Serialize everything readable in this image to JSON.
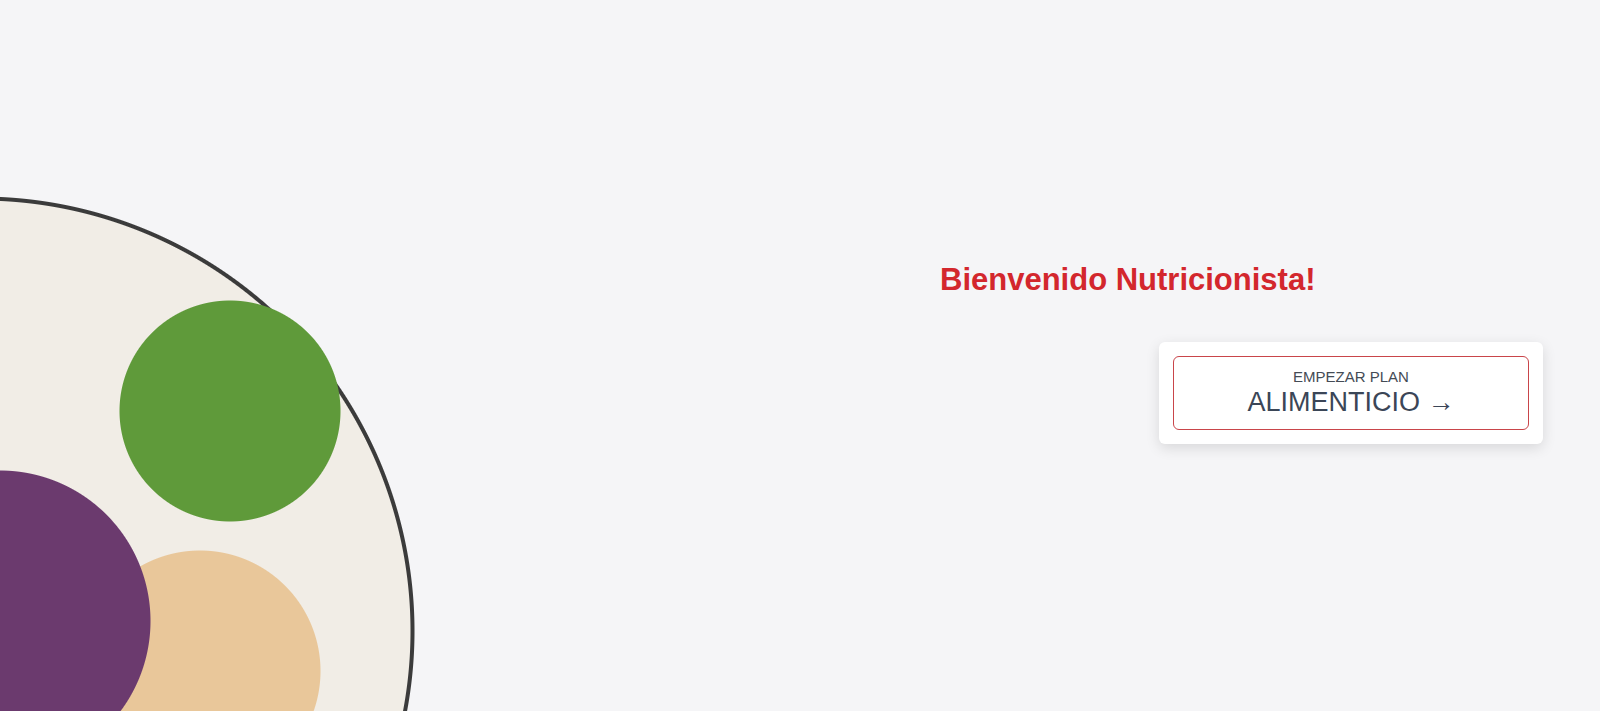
{
  "page": {
    "heading": "Bienvenido Nutricionista!"
  },
  "start_button": {
    "caption": "EMPEZAR PLAN",
    "label": "ALIMENTICIO →"
  }
}
